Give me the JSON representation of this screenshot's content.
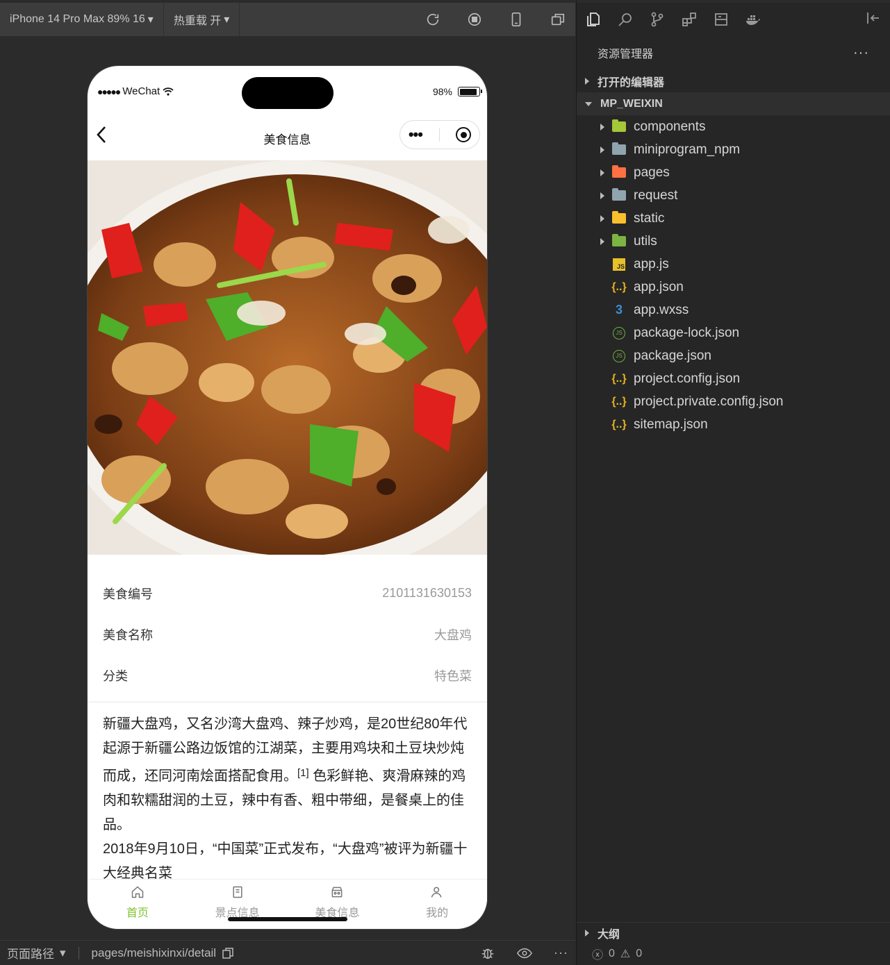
{
  "toolbar": {
    "device": "iPhone 14 Pro Max 89% 16",
    "hot_reload": "热重载 开"
  },
  "phone": {
    "carrier": "WeChat",
    "battery": "98%",
    "nav_title": "美食信息"
  },
  "detail": {
    "fields": [
      {
        "label": "美食编号",
        "value": "2101131630153"
      },
      {
        "label": "美食名称",
        "value": "大盘鸡"
      },
      {
        "label": "分类",
        "value": "特色菜"
      }
    ],
    "desc_p1": "新疆大盘鸡，又名沙湾大盘鸡、辣子炒鸡，是20世纪80年代起源于新疆公路边饭馆的江湖菜，主要用鸡块和土豆块炒炖而成，还同河南烩面搭配食用。",
    "desc_ref": "[1]",
    "desc_p1b": " 色彩鲜艳、爽滑麻辣的鸡肉和软糯甜润的土豆，辣中有香、粗中带细，是餐桌上的佳品。",
    "desc_p2": "2018年9月10日，“中国菜”正式发布，“大盘鸡”被评为新疆十大经典名菜"
  },
  "tabbar": [
    {
      "label": "首页",
      "icon": "home-icon",
      "active": true
    },
    {
      "label": "景点信息",
      "icon": "document-icon",
      "active": false
    },
    {
      "label": "美食信息",
      "icon": "store-icon",
      "active": false
    },
    {
      "label": "我的",
      "icon": "user-icon",
      "active": false
    }
  ],
  "bottombar": {
    "path_label": "页面路径",
    "path": "pages/meishixinxi/detail"
  },
  "explorer": {
    "title": "资源管理器",
    "open_editors": "打开的编辑器",
    "project": "MP_WEIXIN",
    "folders": [
      {
        "name": "components",
        "color": "#a4c639"
      },
      {
        "name": "miniprogram_npm",
        "color": "#90a4ae"
      },
      {
        "name": "pages",
        "color": "#ff7043"
      },
      {
        "name": "request",
        "color": "#90a4ae"
      },
      {
        "name": "static",
        "color": "#fbc02d"
      },
      {
        "name": "utils",
        "color": "#7cb342"
      }
    ],
    "files": [
      {
        "name": "app.js",
        "icon": "js-file-icon"
      },
      {
        "name": "app.json",
        "icon": "json-file-icon"
      },
      {
        "name": "app.wxss",
        "icon": "css-file-icon"
      },
      {
        "name": "package-lock.json",
        "icon": "node-file-icon"
      },
      {
        "name": "package.json",
        "icon": "node-file-icon"
      },
      {
        "name": "project.config.json",
        "icon": "json-file-icon"
      },
      {
        "name": "project.private.config.json",
        "icon": "json-file-icon"
      },
      {
        "name": "sitemap.json",
        "icon": "json-file-icon"
      }
    ],
    "outline": "大纲",
    "errors": "0",
    "warnings": "0"
  }
}
